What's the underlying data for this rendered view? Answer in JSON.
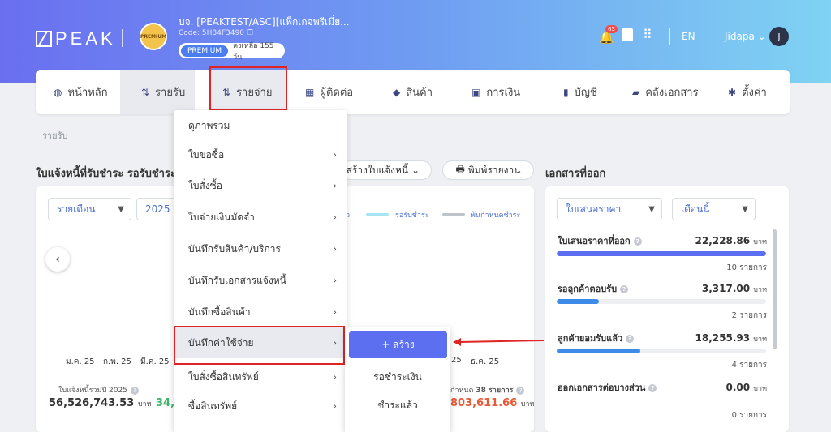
{
  "header": {
    "logo": "PEAK",
    "badge_text": "PREMIUM",
    "company_name": "บจ. [PEAKTEST/ASC][แพ็กเกจพรีเมี่ย...",
    "company_code": "Code: 5H84F3490",
    "plan": "PREMIUM",
    "remaining": "คงเหลือ 155 วัน",
    "notifications": "63",
    "language": "EN",
    "user": "Jidapa",
    "avatar": "J"
  },
  "nav": {
    "items": [
      {
        "label": "หน้าหลัก",
        "icon": "dashboard-icon"
      },
      {
        "label": "รายรับ",
        "icon": "income-icon"
      },
      {
        "label": "รายจ่าย",
        "icon": "expense-icon"
      },
      {
        "label": "ผู้ติดต่อ",
        "icon": "contacts-icon"
      },
      {
        "label": "สินค้า",
        "icon": "box-icon"
      },
      {
        "label": "การเงิน",
        "icon": "money-icon"
      },
      {
        "label": "บัญชี",
        "icon": "book-icon"
      },
      {
        "label": "คลังเอกสาร",
        "icon": "folder-icon"
      },
      {
        "label": "ตั้งค่า",
        "icon": "gear-icon"
      }
    ]
  },
  "breadcrumb": "รายรับ",
  "main": {
    "section_title": "ใบแจ้งหนี้ที่รับชำระ รอรับชำระ และ",
    "create_invoice": "สร้างใบแจ้งหนี้",
    "print_report": "พิมพ์รายงาน",
    "period_select": "รายเดือน",
    "year_select": "2025",
    "legend": [
      {
        "label": "ว",
        "color": "#5b6ff0"
      },
      {
        "label": "รอรับชำระ",
        "color": "#a9e6f5"
      },
      {
        "label": "พ้นกำหนดชำระ",
        "color": "#bfc3ca"
      }
    ],
    "months_left": [
      "ม.ค. 25",
      "ก.พ. 25",
      "มี.ค. 25"
    ],
    "months_right": [
      "25",
      "ธ.ค. 25"
    ],
    "stat1_label": "ใบแจ้งหนี้รวมปี 2025",
    "stat1_value": "56,526,743.53",
    "stat1_unit": "บาท",
    "stat2_value": "34,5",
    "stat3_label_pre": "กำหนด",
    "stat3_label_bold": "38 รายการ",
    "stat3_value": "803,611.66",
    "stat3_unit": "บาท"
  },
  "dropdown": {
    "items": [
      {
        "label": "ดูภาพรวม",
        "arrow": ""
      },
      {
        "label": "ใบขอซื้อ",
        "arrow": "›"
      },
      {
        "label": "ใบสั่งซื้อ",
        "arrow": "›"
      },
      {
        "label": "ใบจ่ายเงินมัดจำ",
        "arrow": "›"
      },
      {
        "label": "บันทึกรับสินค้า/บริการ",
        "arrow": "›"
      },
      {
        "label": "บันทึกรับเอกสารแจ้งหนี้",
        "arrow": "›"
      },
      {
        "label": "บันทึกซื้อสินค้า",
        "arrow": "›"
      },
      {
        "label": "บันทึกค่าใช้จ่าย",
        "arrow": "›"
      },
      {
        "label": "ใบสั่งซื้อสินทรัพย์",
        "arrow": "›"
      },
      {
        "label": "ซื้อสินทรัพย์",
        "arrow": "›"
      }
    ],
    "submenu": {
      "create": "+ สร้าง",
      "items": [
        "รอชำระเงิน",
        "ชำระแล้ว"
      ]
    }
  },
  "docs": {
    "title": "เอกสารที่ออก",
    "type_select": "ใบเสนอราคา",
    "period_select": "เดือนนี้",
    "rows": [
      {
        "label": "ใบเสนอราคาที่ออก",
        "value": "22,228.86",
        "unit": "บาท",
        "count": "10 รายการ",
        "progress": 1.0,
        "color": "#5b6ff0"
      },
      {
        "label": "รอลูกค้าตอบรับ",
        "value": "3,317.00",
        "unit": "บาท",
        "count": "2 รายการ",
        "progress": 0.2,
        "color": "#3d8be8"
      },
      {
        "label": "ลูกค้ายอมรับแล้ว",
        "value": "18,255.93",
        "unit": "บาท",
        "count": "4 รายการ",
        "progress": 0.4,
        "color": "#3d8be8"
      },
      {
        "label": "ออกเอกสารต่อบางส่วน",
        "value": "0.00",
        "unit": "บาท",
        "count": "0 รายการ",
        "progress": 0.0,
        "color": "#3d8be8"
      }
    ]
  }
}
